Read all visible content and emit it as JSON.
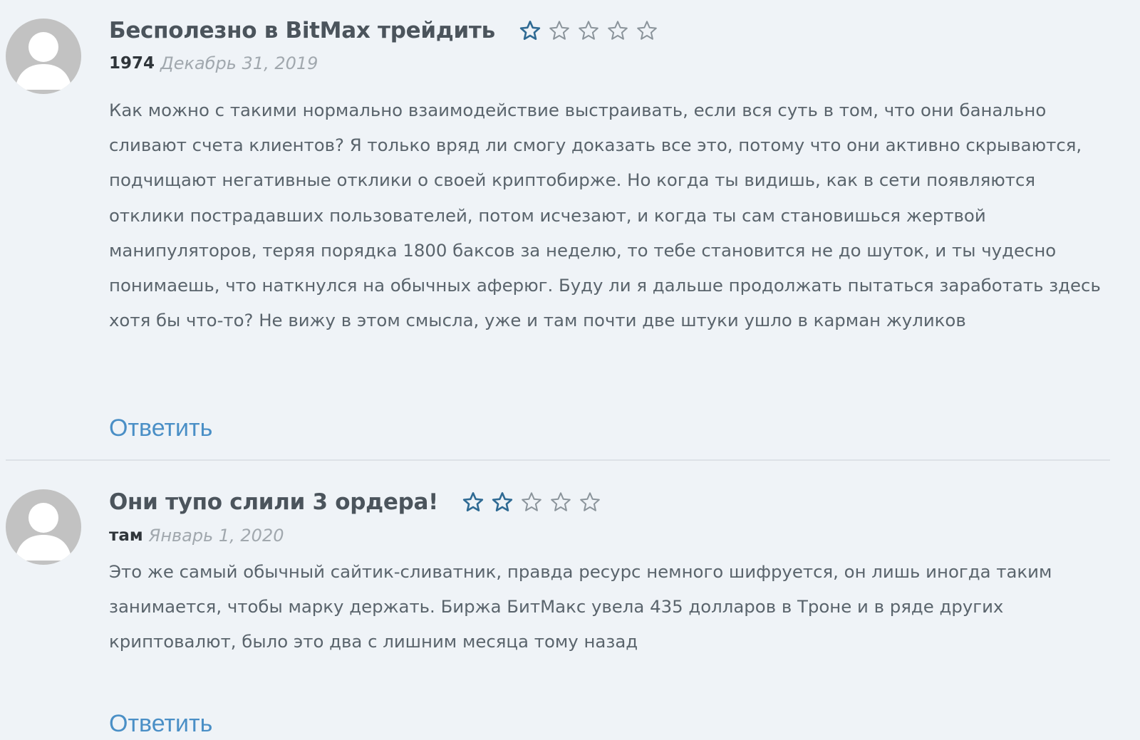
{
  "reviews": [
    {
      "title": "Бесполезно в BitMax трейдить",
      "author": "1974",
      "date": "Декабрь 31, 2019",
      "rating": 1,
      "rating_max": 5,
      "text": "Как можно с такими нормально взаимодействие выстраивать, если вся суть в том, что они банально сливают счета клиентов? Я только вряд ли смогу доказать все это, потому что они активно скрываются, подчищают негативные отклики о своей криптобирже. Но когда ты видишь, как в сети появляются отклики пострадавших пользователей, потом исчезают, и когда ты сам становишься жертвой манипуляторов, теряя порядка 1800 баксов за неделю, то тебе становится не до шуток, и ты чудесно понимаешь, что наткнулся на обычных аферюг. Буду ли я дальше продолжать пытаться заработать здесь хотя бы что-то? Не вижу в этом смысла, уже и там почти две штуки ушло в карман жуликов",
      "reply_label": "Ответить"
    },
    {
      "title": "Они тупо слили 3 ордера!",
      "author": "там",
      "date": "Январь 1, 2020",
      "rating": 2,
      "rating_max": 5,
      "text": "Это же самый обычный сайтик-сливатник, правда ресурс немного шифруется, он лишь иногда таким занимается, чтобы марку держать. Биржа БитМакс увела 435 долларов в Троне и в ряде других криптовалют, было это два с лишним месяца тому назад",
      "reply_label": "Ответить"
    }
  ],
  "icons": {
    "avatar": "default-user-avatar-icon",
    "star": "star-outline-icon"
  },
  "colors": {
    "background": "#eff3f7",
    "star_filled": "#2f6a93",
    "star_empty": "#8b949b",
    "link": "#4a8fc6",
    "avatar": "#c2c2c2"
  }
}
